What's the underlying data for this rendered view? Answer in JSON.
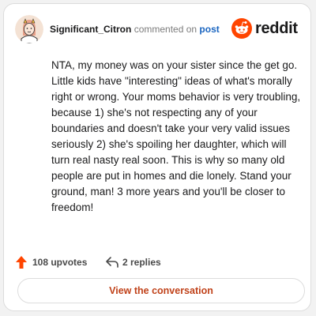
{
  "header": {
    "username": "Significant_Citron",
    "action_text": "commented on",
    "post_link": "post",
    "logo_text": "reddit"
  },
  "comment": {
    "body": "NTA, my money was on your sister since the get go. Little kids have \"interesting\" ideas of what's morally right or wrong. Your moms behavior is very troubling, because 1) she's not respecting any of your boundaries and doesn't take your very valid issues seriously 2) she's spoiling her daughter, which will turn real nasty real soon. This is why so many old people are put in homes and die lonely. Stand your ground, man! 3 more years and you'll be closer to freedom!"
  },
  "stats": {
    "upvotes": "108 upvotes",
    "replies": "2 replies"
  },
  "cta": {
    "label": "View the conversation"
  },
  "colors": {
    "brand": "#ff4500",
    "link": "#1a65c0",
    "cta_text": "#c0421a",
    "upvote_arrow": "#ff4500"
  },
  "icons": {
    "avatar": "avatar-icon",
    "logo": "reddit-logo-icon",
    "upvote": "upvote-arrow-icon",
    "reply": "reply-arrow-icon"
  }
}
